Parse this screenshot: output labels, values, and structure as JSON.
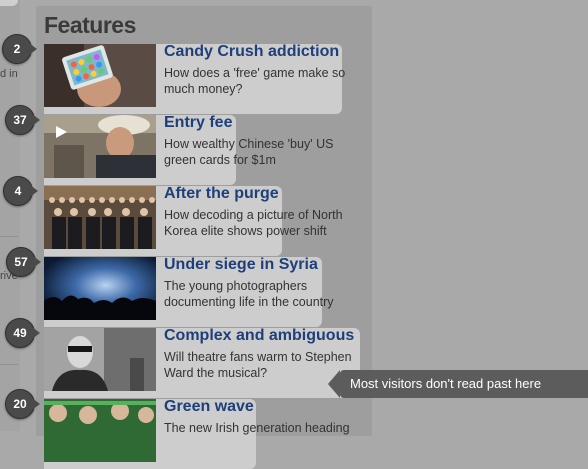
{
  "left_fragments": [
    "d in",
    "rive"
  ],
  "section": {
    "heading": "Features"
  },
  "stories": [
    {
      "rank": "2",
      "title": "Candy Crush addiction",
      "desc": "How does a 'free' game make so much money?"
    },
    {
      "rank": "37",
      "title": "Entry fee",
      "desc": "How wealthy Chinese 'buy' US green cards for $1m"
    },
    {
      "rank": "4",
      "title": "After the purge",
      "desc": "How decoding a picture of North Korea elite shows power shift"
    },
    {
      "rank": "57",
      "title": "Under siege in Syria",
      "desc": "The young photographers documenting life in the country"
    },
    {
      "rank": "49",
      "title": "Complex and ambiguous",
      "desc": "Will theatre fans warm to Stephen Ward the musical?"
    },
    {
      "rank": "20",
      "title": "Green wave",
      "desc": "The new Irish generation heading"
    }
  ],
  "callout": {
    "text": "Most visitors don't read past here"
  },
  "icons": {
    "video": "play-icon"
  },
  "colors": {
    "title": "#1e3f7a",
    "badge": "#4a4a4a",
    "callout": "#5c5c5c"
  }
}
